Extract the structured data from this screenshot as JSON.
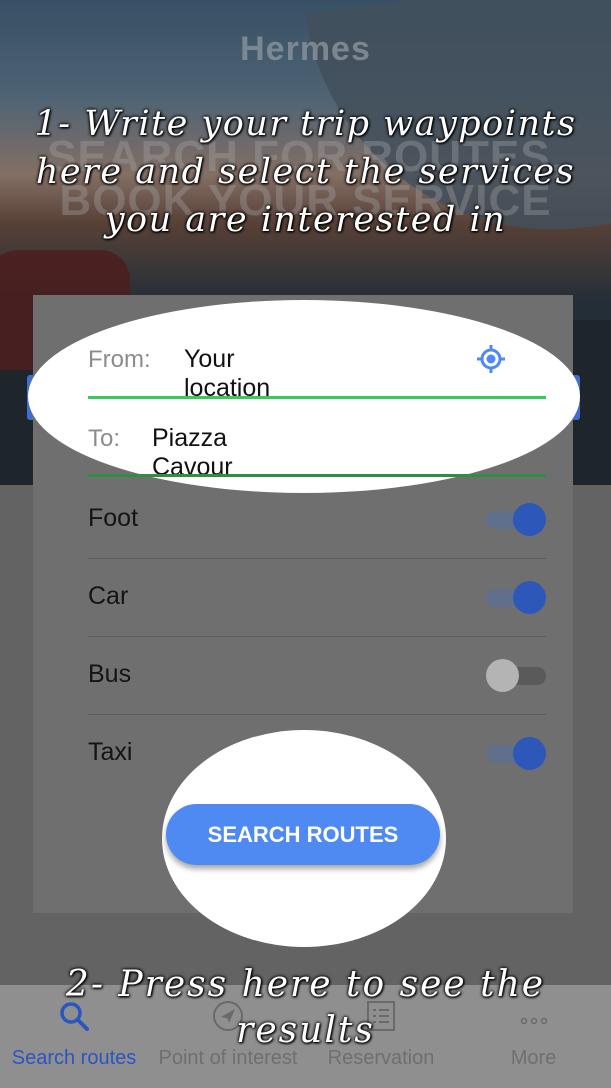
{
  "app": {
    "title": "Hermes",
    "tagline_line1": "SEARCH FOR ROUTES,",
    "tagline_line2": "BOOK YOUR SERVICE"
  },
  "form": {
    "from_label": "From:",
    "from_value": "Your location",
    "to_label": "To:",
    "to_value": "Piazza Cavour",
    "location_icon": "gps-target-icon"
  },
  "services": [
    {
      "label": "Foot",
      "enabled": true
    },
    {
      "label": "Car",
      "enabled": true
    },
    {
      "label": "Bus",
      "enabled": false
    },
    {
      "label": "Taxi",
      "enabled": true
    }
  ],
  "search_button": {
    "label": "SEARCH ROUTES"
  },
  "nav": [
    {
      "label": "Search routes",
      "icon": "search-icon",
      "active": true
    },
    {
      "label": "Point of interest",
      "icon": "navigation-icon",
      "active": false
    },
    {
      "label": "Reservation",
      "icon": "list-icon",
      "active": false
    },
    {
      "label": "More",
      "icon": "more-icon",
      "active": false
    }
  ],
  "hints": {
    "step1_line1": "1- Write your trip waypoints",
    "step1_line2": "here and select the services",
    "step1_line3": "you are interested in",
    "step2_line1": "2- Press here to see the",
    "step2_line2": "results"
  },
  "colors": {
    "accent": "#4f89f2",
    "active_nav": "#2b55c2",
    "underline": "#3dc95a",
    "toggle_on": "#2d57b8"
  }
}
